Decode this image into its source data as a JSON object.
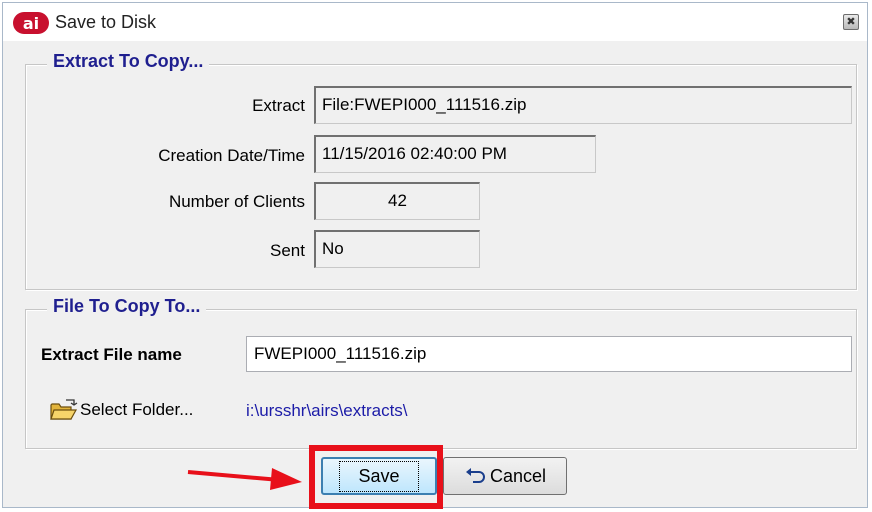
{
  "window": {
    "title": "Save to Disk",
    "logo_text": "ai",
    "close_glyph": "✖"
  },
  "extract_group": {
    "legend": "Extract To Copy...",
    "extract_label": "Extract",
    "extract_value": "File:FWEPI000_111516.zip",
    "creation_label": "Creation Date/Time",
    "creation_value": "11/15/2016 02:40:00 PM",
    "clients_label": "Number of Clients",
    "clients_value": "42",
    "sent_label": "Sent",
    "sent_value": "No"
  },
  "file_group": {
    "legend": "File To Copy To...",
    "filename_label": "Extract File name",
    "filename_value": "FWEPI000_111516.zip",
    "select_folder_label": "Select Folder...",
    "folder_path": "i:\\ursshr\\airs\\extracts\\"
  },
  "buttons": {
    "save_label": "Save",
    "cancel_label": "Cancel"
  },
  "icons": {
    "logo": "app-logo-icon",
    "folder": "open-folder-icon",
    "undo": "undo-arrow-icon",
    "close": "close-icon",
    "annotation_arrow": "red-arrow-icon"
  },
  "colors": {
    "legend_text": "#1f1f8f",
    "folder_link": "#1c1ca8",
    "annotation": "#e8101a",
    "logo_bg": "#c8102e"
  }
}
